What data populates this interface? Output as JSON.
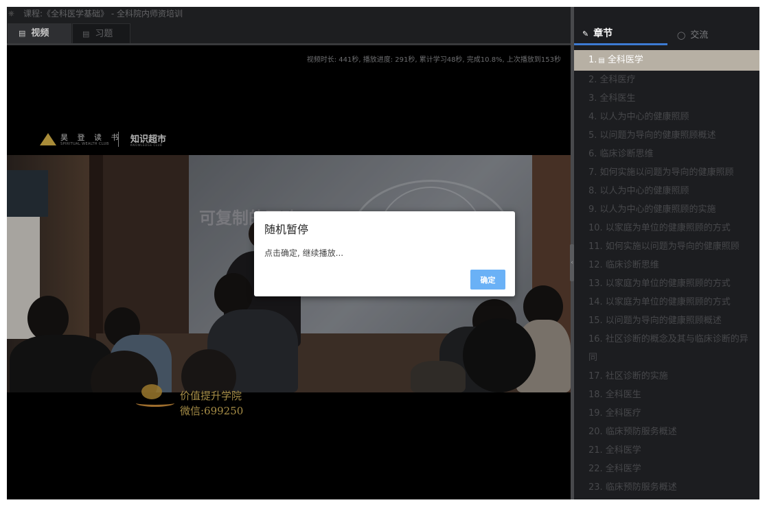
{
  "window": {
    "title": "课程:《全科医学基础》 - 全科院内师资培训",
    "title_icon": "course-icon"
  },
  "tabs": [
    {
      "label": "视频",
      "icon": "video-icon",
      "active": true
    },
    {
      "label": "习题",
      "icon": "exercise-icon",
      "active": false
    }
  ],
  "video": {
    "progress_text": "视频时长: 441秒, 播放进度: 291秒, 累计学习48秒, 完成10.8%, 上次播放到153秒",
    "logo_left_cn": "昊 登 读 书",
    "logo_left_en": "SPIRITUAL WEALTH CLUB",
    "logo_right_cn": "知识超市",
    "logo_right_en": "KNOWLEDGE CLUB",
    "slide_text": "可复制的医改",
    "watermark_line1": "价值提升学院",
    "watermark_line2": "微信:699250"
  },
  "dialog": {
    "title": "随机暂停",
    "message": "点击确定, 继续播放...",
    "confirm_label": "确定"
  },
  "sidebar": {
    "tabs": [
      {
        "label": "章节",
        "icon": "chapter-icon",
        "active": true
      },
      {
        "label": "交流",
        "icon": "chat-icon",
        "active": false
      }
    ],
    "chapters": [
      {
        "label": "1. 全科医学",
        "active": true
      },
      {
        "label": "2. 全科医疗"
      },
      {
        "label": "3. 全科医生"
      },
      {
        "label": "4. 以人为中心的健康照顾"
      },
      {
        "label": "5. 以问题为导向的健康照顾概述"
      },
      {
        "label": "6. 临床诊断思维"
      },
      {
        "label": "7. 如何实施以问题为导向的健康照顾"
      },
      {
        "label": "8. 以人为中心的健康照顾"
      },
      {
        "label": "9. 以人为中心的健康照顾的实施"
      },
      {
        "label": "10. 以家庭为单位的健康照顾的方式"
      },
      {
        "label": "11. 如何实施以问题为导向的健康照顾"
      },
      {
        "label": "12. 临床诊断思维"
      },
      {
        "label": "13. 以家庭为单位的健康照顾的方式"
      },
      {
        "label": "14. 以家庭为单位的健康照顾的方式"
      },
      {
        "label": "15. 以问题为导向的健康照顾概述"
      },
      {
        "label": "16. 社区诊断的概念及其与临床诊断的异同"
      },
      {
        "label": "17. 社区诊断的实施"
      },
      {
        "label": "18. 全科医生"
      },
      {
        "label": "19. 全科医疗"
      },
      {
        "label": "20. 临床预防服务概述"
      },
      {
        "label": "21. 全科医学"
      },
      {
        "label": "22. 全科医学"
      },
      {
        "label": "23. 临床预防服务概述"
      }
    ]
  }
}
